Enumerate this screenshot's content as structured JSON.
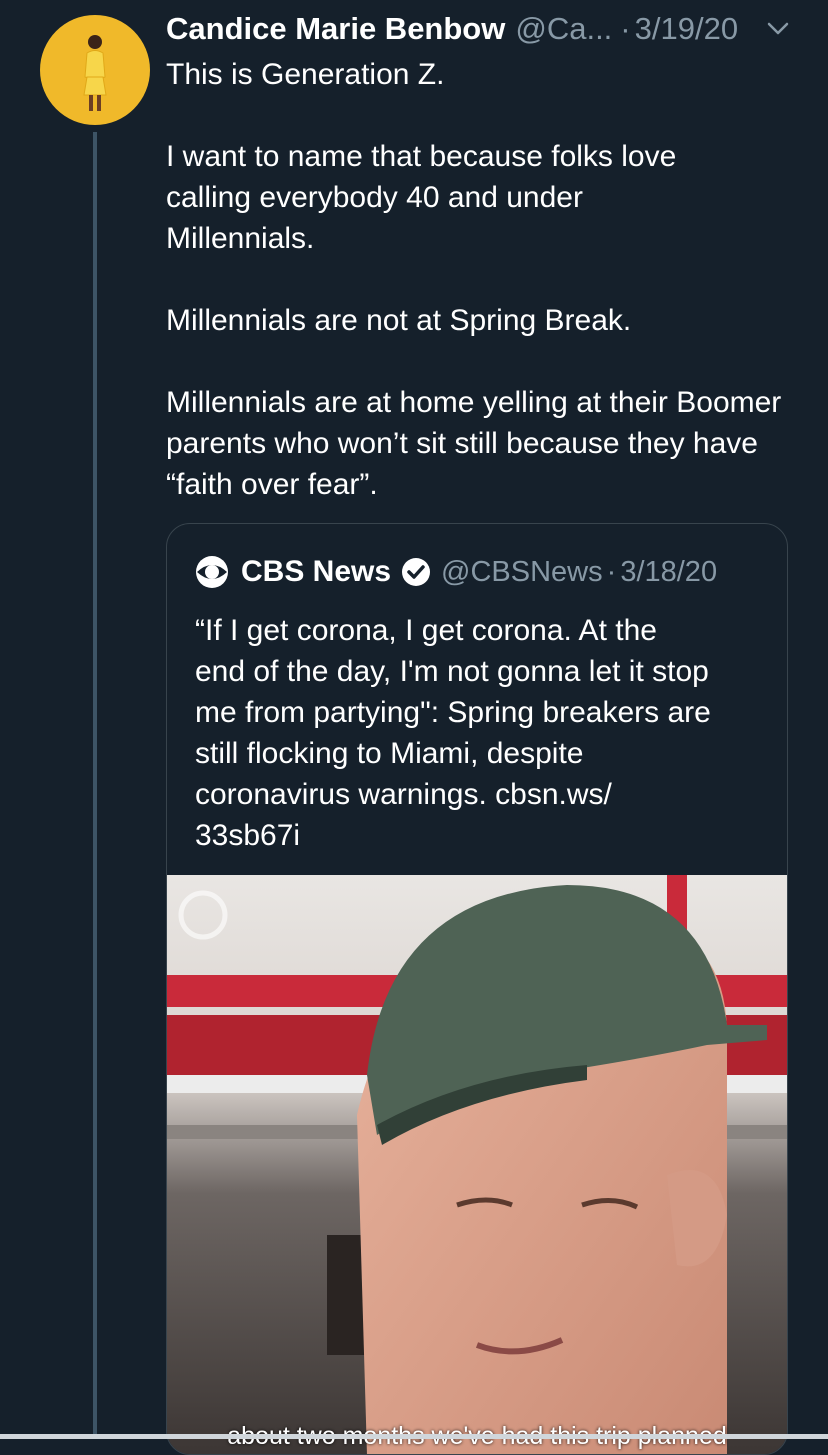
{
  "tweet": {
    "author_name": "Candice Marie Benbow",
    "handle": "@Ca...",
    "separator": "·",
    "date": "3/19/20",
    "paragraphs": [
      "This is Generation Z.",
      "I want to name that because folks love calling everybody 40 and under Millennials.",
      "Millennials are not at Spring Break.",
      "Millennials are at home yelling at their Boomer parents who won’t sit still because they have “faith over fear”."
    ],
    "icons": {
      "avatar": "profile-photo",
      "menu": "chevron-down-icon"
    }
  },
  "quoted_tweet": {
    "author_name": "CBS News",
    "handle": "@CBSNews",
    "separator": "·",
    "date": "3/18/20",
    "text_lines": [
      "“If I get corona, I get corona. At the",
      "end of the day, I'm not gonna let it stop",
      "me from partying\": Spring breakers are",
      "still flocking to Miami, despite",
      "coronavirus warnings. cbsn.ws/",
      "33sb67i"
    ],
    "video_caption": "about two months we've had this trip planned",
    "icons": {
      "logo": "cbs-eye-logo",
      "verified": "verified-badge-icon"
    }
  },
  "colors": {
    "background": "#15202b",
    "secondary_text": "#8899a6",
    "border": "#38444d",
    "avatar_bg": "#f0b92a"
  }
}
